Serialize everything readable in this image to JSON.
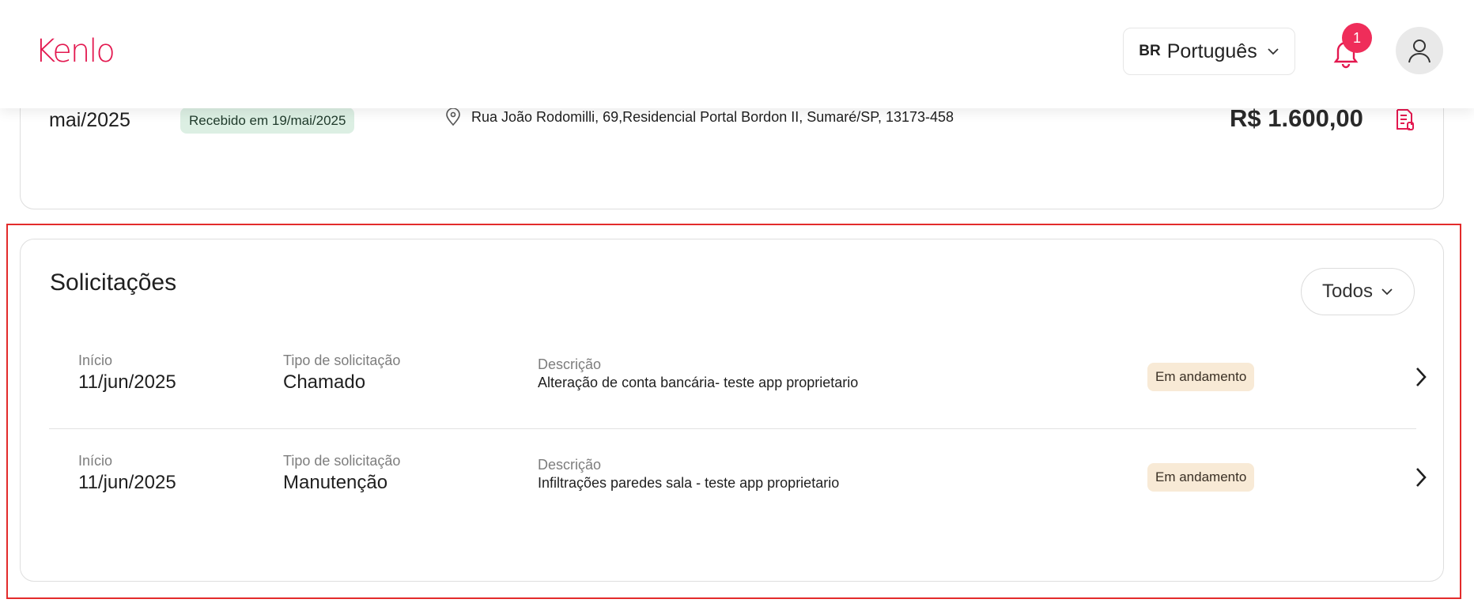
{
  "header": {
    "logo_text": "Kenlo",
    "language": {
      "flag": "BR",
      "label": "Português"
    },
    "notifications_count": "1"
  },
  "previous_card": {
    "month": "mai/2025",
    "status": "Recebido em 19/mai/2025",
    "address": "Rua João Rodomilli, 69,Residencial Portal Bordon II, Sumaré/SP, 13173-458",
    "amount": "R$ 1.600,00"
  },
  "requests": {
    "title": "Solicitações",
    "filter_label": "Todos",
    "items": [
      {
        "start_label": "Início",
        "start_value": "11/jun/2025",
        "type_label": "Tipo de solicitação",
        "type_value": "Chamado",
        "desc_label": "Descrição",
        "desc_value": "Alteração de conta bancária- teste app proprietario",
        "status": "Em andamento"
      },
      {
        "start_label": "Início",
        "start_value": "11/jun/2025",
        "type_label": "Tipo de solicitação",
        "type_value": "Manutenção",
        "desc_label": "Descrição",
        "desc_value": "Infiltrações paredes sala - teste app proprietario",
        "status": "Em andamento"
      }
    ]
  },
  "colors": {
    "brand": "#e3184f",
    "badge": "#ef2d5a",
    "received_bg": "#dcefe3",
    "in_progress_bg": "#f8ead6",
    "highlight_border": "#e32b2b"
  }
}
